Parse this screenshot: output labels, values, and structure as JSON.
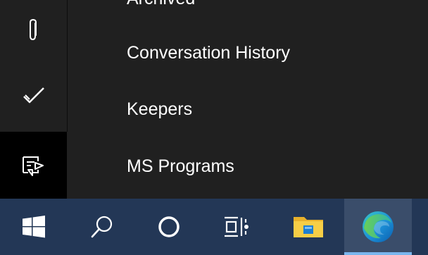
{
  "window": {
    "folders": [
      {
        "label": "Archived"
      },
      {
        "label": "Conversation History"
      },
      {
        "label": "Keepers"
      },
      {
        "label": "MS Programs"
      }
    ]
  },
  "rail": {
    "buttons": [
      {
        "icon": "paperclip-icon"
      },
      {
        "icon": "checkmark-icon"
      },
      {
        "icon": "shortcuts-icon",
        "active": true
      }
    ]
  },
  "taskbar": {
    "buttons": [
      {
        "icon": "windows-start-icon"
      },
      {
        "icon": "search-icon"
      },
      {
        "icon": "cortana-icon"
      },
      {
        "icon": "task-view-icon"
      },
      {
        "icon": "file-explorer-icon"
      },
      {
        "icon": "edge-browser-icon",
        "active": true
      }
    ]
  },
  "colors": {
    "background": "#202020",
    "rail_active": "#000000",
    "taskbar": "#233756",
    "taskbar_active": "#3a4d6a",
    "running_indicator": "#7ab6ee",
    "text": "#ffffff"
  }
}
